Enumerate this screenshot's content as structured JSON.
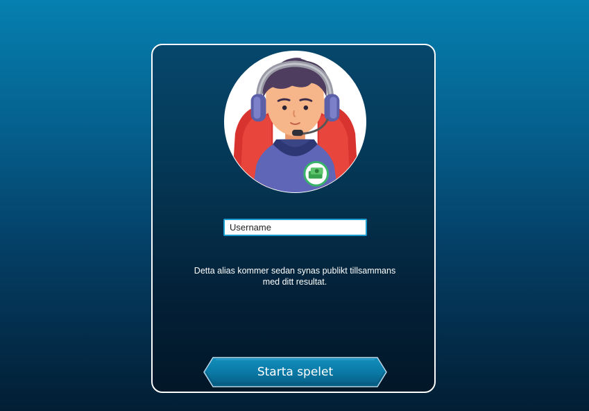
{
  "login": {
    "avatar_icon": "gamer-avatar-icon",
    "badge_icon": "money-badge-icon",
    "username_placeholder": "Username",
    "info_text_line1": "Detta alias kommer sedan synas publikt tillsammans",
    "info_text_line2": "med ditt resultat.",
    "start_button_label": "Starta spelet"
  },
  "colors": {
    "background_top": "#0580b0",
    "background_bottom": "#021e34",
    "panel_border": "#ffffff",
    "button_fill": "#0a7ba5",
    "input_border": "#1a9dd0"
  }
}
